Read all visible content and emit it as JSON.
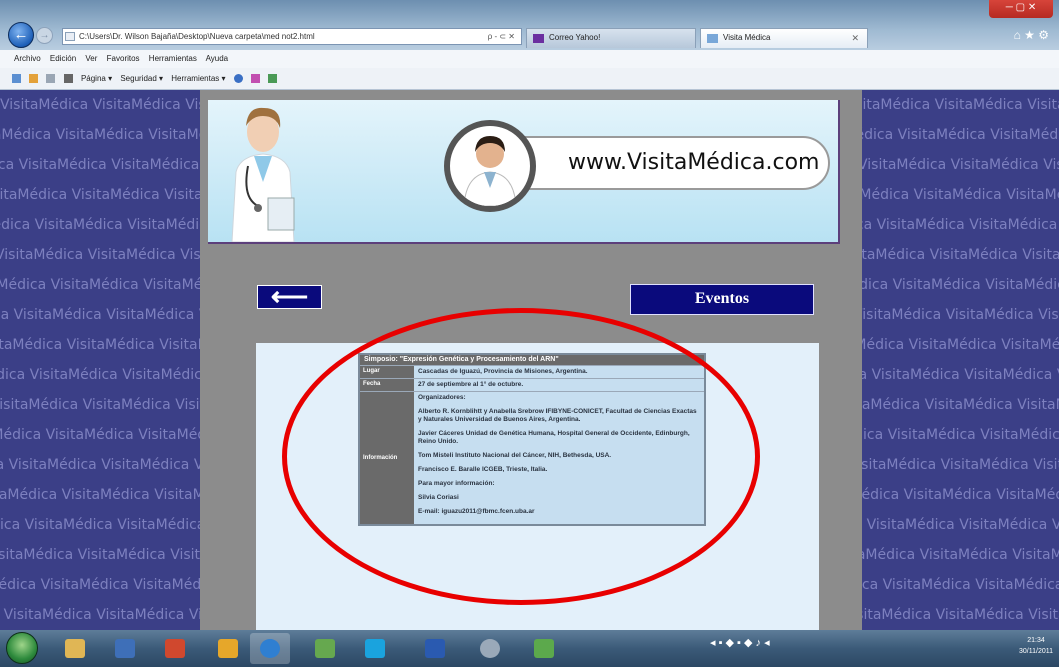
{
  "browser": {
    "address": "C:\\Users\\Dr. Wilson Bajaña\\Desktop\\Nueva carpeta\\med not2.html",
    "address_tools": "ρ - ⊂ ✕",
    "tabs": [
      {
        "label": "Correo Yahoo!"
      },
      {
        "label": "Visita Médica"
      }
    ],
    "tab_close": "✕",
    "window_controls": "─ ▢ ✕",
    "chrome_icons": "⌂ ★ ⚙"
  },
  "menu": {
    "items": [
      "Archivo",
      "Edición",
      "Ver",
      "Favoritos",
      "Herramientas",
      "Ayuda"
    ]
  },
  "command_bar": {
    "items": [
      "Página ▾",
      "Seguridad ▾",
      "Herramientas ▾"
    ]
  },
  "background_pattern_text": "VisitaMédica",
  "page": {
    "logo_text": "www.VisitaMédica.com",
    "back_arrow": "⟵",
    "section_button": "Eventos",
    "table": {
      "title": "Simposio: \"Expresión Genética y Procesamiento del ARN\"",
      "rows": [
        {
          "label": "Lugar",
          "value": "Cascadas de Iguazú, Provincia de Misiones, Argentina."
        },
        {
          "label": "Fecha",
          "value": "27 de septiembre al 1° de octubre."
        }
      ],
      "info_label": "Información",
      "info_paragraphs": [
        "Organizadores:",
        "Alberto R. Kornblihtt y Anabella Srebrow IFIBYNE-CONICET, Facultad de Ciencias Exactas y Naturales Universidad de Buenos Aires, Argentina.",
        "Javier Cáceres Unidad de Genética Humana, Hospital General de Occidente, Edinburgh, Reino Unido.",
        "Tom Misteli Instituto Nacional del Cáncer, NIH, Bethesda, USA.",
        "Francisco E. Baralle ICGEB, Trieste, Italia.",
        "Para mayor información:",
        "Silvia Coriasi",
        "E-mail: iguazu2011@fbmc.fcen.uba.ar"
      ]
    }
  },
  "taskbar": {
    "tray_icons": "◂ ▪ ◆ ▪ ◆ ♪ ◂",
    "time": "21:34",
    "date": "30/11/2011"
  },
  "colors": {
    "annotation_ellipse": "#e80000",
    "nav_button": "#0a0a7c",
    "pattern_background": "#3b3f87"
  }
}
